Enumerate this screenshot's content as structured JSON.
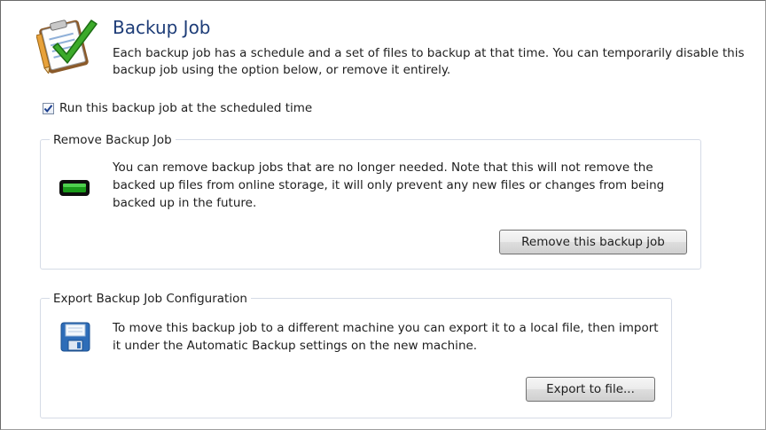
{
  "header": {
    "title": "Backup Job",
    "description": "Each backup job has a schedule and a set of files to backup at that time. You can temporarily disable this backup job using the option below, or remove it entirely."
  },
  "schedule": {
    "checkbox_label": "Run this backup job at the scheduled time",
    "checked": true
  },
  "remove_group": {
    "title": "Remove Backup Job",
    "description": "You can remove backup jobs that are no longer needed. Note that this will not remove the backed up files from online storage, it will only prevent any new files or changes from being backed up in the future.",
    "button_label": "Remove this backup job",
    "icon": "remove-icon"
  },
  "export_group": {
    "title": "Export Backup Job Configuration",
    "description": "To move this backup job to a different machine you can export it to a local file, then import it under the Automatic Backup settings on the new machine.",
    "button_label": "Export to file...",
    "icon": "floppy-disk-icon"
  },
  "colors": {
    "title": "#1e3d78",
    "group_border": "#d5dbe6",
    "remove_icon_fill": "#1a9a1a",
    "floppy_blue": "#2e6db8"
  }
}
